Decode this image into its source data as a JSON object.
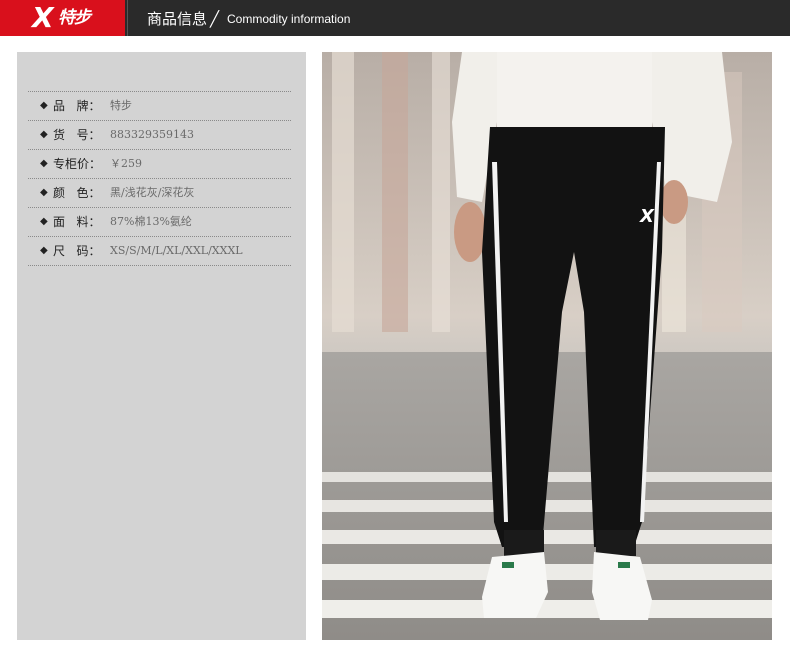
{
  "header": {
    "logo_mark": "X",
    "logo_text": "特步",
    "title": "商品信息",
    "slash": "╱",
    "subtitle": "Commodity information"
  },
  "info": {
    "bullet": "◆",
    "rows": [
      {
        "label": "品   牌：",
        "value": "特步"
      },
      {
        "label": "货   号：",
        "value": "883329359143"
      },
      {
        "label": "专柜价：",
        "value": "￥259"
      },
      {
        "label": "颜   色：",
        "value": "黑/浅花灰/深花灰"
      },
      {
        "label": "面   料：",
        "value": "87%棉13%氨纶"
      },
      {
        "label": "尺   码：",
        "value": "XS/S/M/L/XL/XXL/XXXL"
      }
    ]
  },
  "photo": {
    "alt": "model wearing black track pants with white side stripes and white sneakers",
    "logo_mark": "X"
  },
  "colors": {
    "brand_red": "#d9101c",
    "header_bg": "#2a2a2a",
    "panel_bg": "#d3d3d3"
  }
}
